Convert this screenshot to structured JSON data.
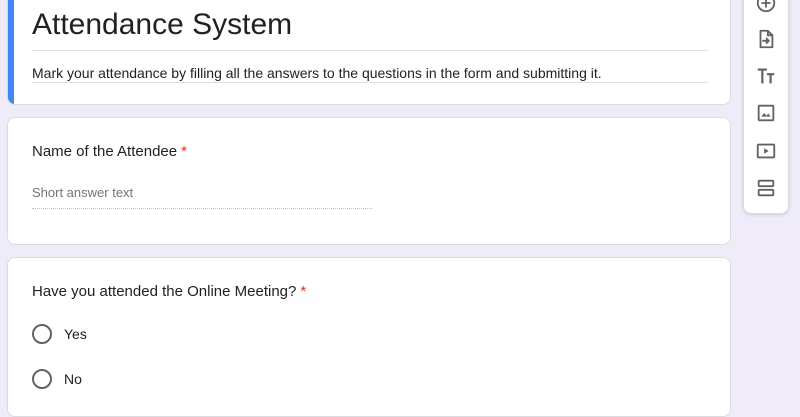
{
  "form": {
    "title": "Attendance System",
    "description": "Mark your attendance by filling all the answers to the questions in the form and submitting it.",
    "accent_color": "#4285f4"
  },
  "questions": [
    {
      "title": "Name of the Attendee",
      "required_mark": "*",
      "type": "short-answer",
      "placeholder": "Short answer text"
    },
    {
      "title": "Have you attended the Online Meeting?",
      "required_mark": "*",
      "type": "multiple-choice",
      "options": [
        "Yes",
        "No"
      ]
    }
  ],
  "toolbar": {
    "tools": [
      "add-question-icon",
      "import-questions-icon",
      "add-title-icon",
      "add-image-icon",
      "add-video-icon",
      "add-section-icon"
    ]
  },
  "colors": {
    "background": "#f0ebf8",
    "required": "#d93025",
    "icon": "#5f6368"
  }
}
